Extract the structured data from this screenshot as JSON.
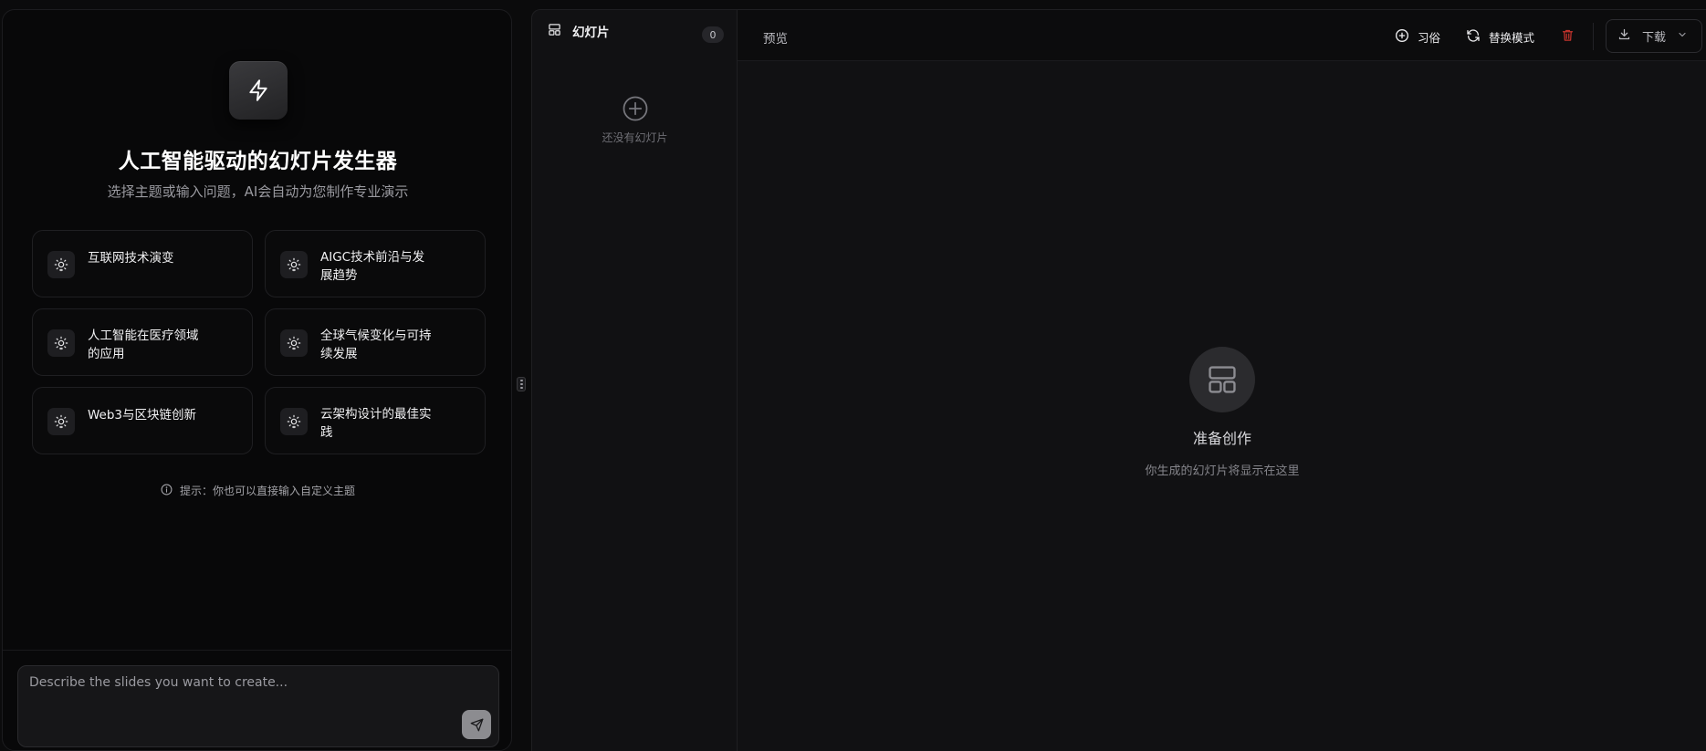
{
  "left_panel": {
    "hero_icon": "lightning-icon",
    "title": "人工智能驱动的幻灯片发生器",
    "subtitle": "选择主题或输入问题，AI会自动为您制作专业演示",
    "topics": [
      {
        "label": "互联网技术演变",
        "icon": "lightbulb-icon"
      },
      {
        "label": "AIGC技术前沿与发展趋势",
        "icon": "lightbulb-icon"
      },
      {
        "label": "人工智能在医疗领域的应用",
        "icon": "lightbulb-icon"
      },
      {
        "label": "全球气候变化与可持续发展",
        "icon": "lightbulb-icon"
      },
      {
        "label": "Web3与区块链创新",
        "icon": "lightbulb-icon"
      },
      {
        "label": "云架构设计的最佳实践",
        "icon": "lightbulb-icon"
      }
    ],
    "hint": "提示：你也可以直接输入自定义主题",
    "input_placeholder": "Describe the slides you want to create...",
    "input_value": ""
  },
  "slides_panel": {
    "title": "幻灯片",
    "count": "0",
    "empty_text": "还没有幻灯片"
  },
  "preview": {
    "title": "预览",
    "buttons": {
      "custom": "习俗",
      "switch_mode": "替换模式",
      "download": "下载"
    },
    "ready_title": "准备创作",
    "ready_subtitle": "你生成的幻灯片将显示在这里"
  },
  "colors": {
    "background": "#0b0b0c",
    "panel": "#111113",
    "danger": "#c2332c",
    "text_primary": "#ffffff",
    "text_muted": "#9a9aa0"
  }
}
